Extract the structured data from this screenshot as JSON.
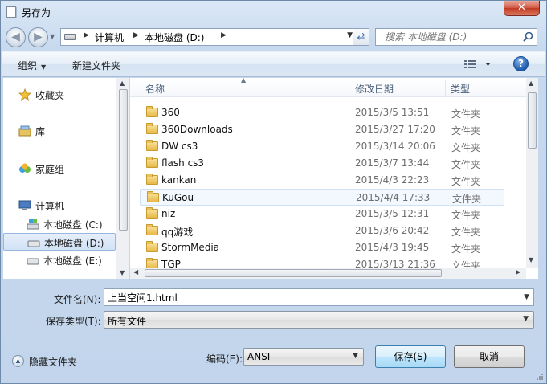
{
  "window": {
    "title": "另存为",
    "close_label": "✕"
  },
  "address": {
    "parts": [
      "计算机",
      "本地磁盘 (D:)"
    ]
  },
  "search": {
    "placeholder": "搜索 本地磁盘 (D:)"
  },
  "toolbar": {
    "organize": "组织",
    "new_folder": "新建文件夹"
  },
  "sidebar": {
    "favorites": "收藏夹",
    "libraries": "库",
    "homegroup": "家庭组",
    "computer": "计算机",
    "drives": [
      "本地磁盘 (C:)",
      "本地磁盘 (D:)",
      "本地磁盘 (E:)"
    ],
    "selected_drive": "本地磁盘 (D:)"
  },
  "columns": {
    "name": "名称",
    "modified": "修改日期",
    "type": "类型"
  },
  "files": [
    {
      "name": "360",
      "modified": "2015/3/5 13:51",
      "type": "文件夹"
    },
    {
      "name": "360Downloads",
      "modified": "2015/3/27 17:20",
      "type": "文件夹"
    },
    {
      "name": "DW cs3",
      "modified": "2015/3/14 20:06",
      "type": "文件夹"
    },
    {
      "name": "flash cs3",
      "modified": "2015/3/7 13:44",
      "type": "文件夹"
    },
    {
      "name": "kankan",
      "modified": "2015/4/3 22:23",
      "type": "文件夹"
    },
    {
      "name": "KuGou",
      "modified": "2015/4/4 17:33",
      "type": "文件夹"
    },
    {
      "name": "niz",
      "modified": "2015/3/5 12:31",
      "type": "文件夹"
    },
    {
      "name": "qq游戏",
      "modified": "2015/3/6 20:42",
      "type": "文件夹"
    },
    {
      "name": "StormMedia",
      "modified": "2015/4/3 19:45",
      "type": "文件夹"
    },
    {
      "name": "TGP",
      "modified": "2015/3/13 21:36",
      "type": "文件夹"
    }
  ],
  "hovered_file": "KuGou",
  "form": {
    "filename_label": "文件名(N):",
    "filename_value": "上当空间1.html",
    "savetype_label": "保存类型(T):",
    "savetype_value": "所有文件",
    "encoding_label": "编码(E):",
    "encoding_value": "ANSI"
  },
  "buttons": {
    "save": "保存(S)",
    "cancel": "取消"
  },
  "hide_folders": "隐藏文件夹",
  "colors": {
    "window_frame": "#c7d9ee",
    "hover_row": "#f3f8fe",
    "selected_sidebar": "#d1e2f6",
    "primary_button": "#bee6fd"
  }
}
